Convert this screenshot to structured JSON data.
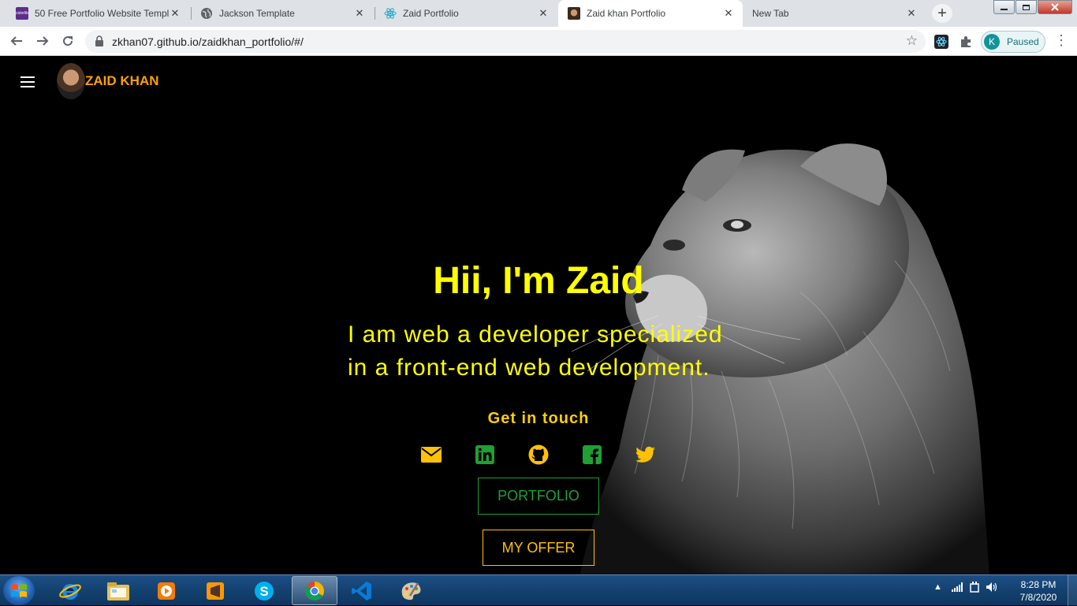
{
  "browser": {
    "tabs": [
      {
        "title": "50 Free Portfolio Website Templ",
        "favicon": "colorlib-icon",
        "active": false
      },
      {
        "title": "Jackson Template",
        "favicon": "globe-icon",
        "active": false
      },
      {
        "title": "Zaid Portfolio",
        "favicon": "react-icon",
        "active": false
      },
      {
        "title": "Zaid khan Portfolio",
        "favicon": "avatar-icon",
        "active": true
      },
      {
        "title": "New Tab",
        "favicon": "",
        "active": false
      }
    ],
    "close_glyph": "✕",
    "new_tab_glyph": "+",
    "url": "zkhan07.github.io/zaidkhan_portfolio/#/",
    "profile_initial": "K",
    "profile_status": "Paused"
  },
  "page": {
    "brand_name": "ZAID KHAN",
    "hero_title": "Hii, I'm Zaid",
    "hero_line1": "I am web a developer specialized",
    "hero_line2": "in a front-end web development.",
    "get_in_touch": "Get in touch",
    "social_icons": [
      "mail-icon",
      "linkedin-icon",
      "github-icon",
      "facebook-icon",
      "twitter-icon"
    ],
    "portfolio_button": "PORTFOLIO",
    "offer_button": "MY OFFER",
    "colors": {
      "headline": "#ffff00",
      "brand": "#ffa200",
      "portfolio": "#1fa033",
      "offer": "#ffc107"
    }
  },
  "taskbar": {
    "items": [
      "ie-icon",
      "explorer-icon",
      "media-player-icon",
      "sublime-icon",
      "skype-icon",
      "chrome-icon",
      "vscode-icon",
      "paint-icon"
    ],
    "active_item": "chrome-icon",
    "time": "8:28 PM",
    "date": "7/8/2020"
  }
}
